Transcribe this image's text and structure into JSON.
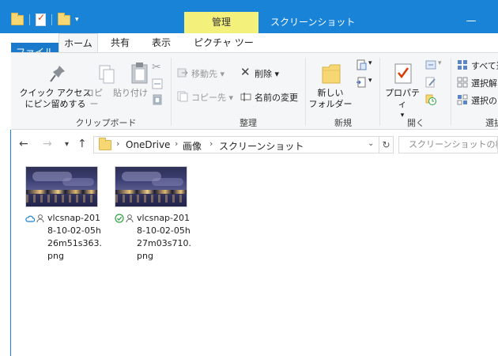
{
  "window": {
    "title": "スクリーンショット",
    "context_tab": "管理"
  },
  "tabs": {
    "file": "ファイル",
    "home": "ホーム",
    "share": "共有",
    "view": "表示",
    "picture_tools": "ピクチャ ツール"
  },
  "ribbon": {
    "clipboard": {
      "group_label": "クリップボード",
      "pin": "クイック アクセス\nにピン留めする",
      "pin_line1": "クイック アクセス",
      "pin_line2": "にピン留めする",
      "copy": "コピー",
      "paste": "貼り付け"
    },
    "organize": {
      "group_label": "整理",
      "move_to": "移動先",
      "copy_to": "コピー先",
      "delete": "削除",
      "rename": "名前の変更"
    },
    "new": {
      "group_label": "新規",
      "new_folder_line1": "新しい",
      "new_folder_line2": "フォルダー"
    },
    "open": {
      "group_label": "開く",
      "properties": "プロパティ"
    },
    "select": {
      "group_label": "選択",
      "select_all": "すべて選",
      "select_none": "選択解",
      "invert": "選択の"
    }
  },
  "address": {
    "crumbs": [
      "OneDrive",
      "画像",
      "スクリーンショット"
    ],
    "search_placeholder": "スクリーンショットの検索"
  },
  "files": [
    {
      "name": "vlcsnap-2018-10-02-05h26m51s363.png",
      "status": "cloud-icon"
    },
    {
      "name": "vlcsnap-2018-10-02-05h27m03s710.png",
      "status": "synced-check-icon"
    }
  ],
  "colors": {
    "title_bar": "#1883d7",
    "context_tab": "#f4f07c",
    "file_tab": "#1979ca",
    "ribbon_bg": "#f5f6f7",
    "cloud_status": "#1883d7",
    "synced_status": "#2ea043"
  }
}
